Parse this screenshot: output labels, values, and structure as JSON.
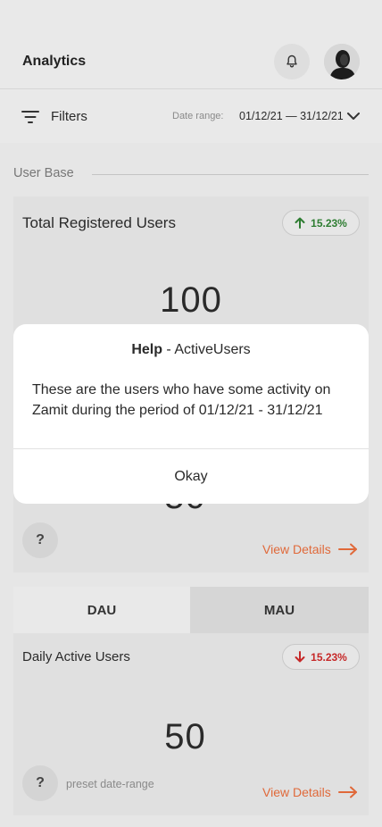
{
  "header": {
    "title": "Analytics",
    "bell_icon": "bell-icon",
    "avatar_icon": "user-avatar"
  },
  "filters": {
    "label": "Filters",
    "date_range_label": "Date range:",
    "date_range_value": "01/12/21 — 31/12/21"
  },
  "section": {
    "title": "User Base"
  },
  "registered_card": {
    "title": "Total Registered Users",
    "badge": "15.23%",
    "badge_direction": "up",
    "value": "100",
    "partial_value": "50",
    "help_label": "?",
    "view_details": "View Details"
  },
  "active_card": {
    "tabs": [
      "DAU",
      "MAU"
    ],
    "title": "Daily Active Users",
    "badge": "15.23%",
    "badge_direction": "down",
    "value": "50",
    "help_label": "?",
    "preset": "preset date-range",
    "view_details": "View Details"
  },
  "help_modal": {
    "title_bold": "Help",
    "title_rest": " - ActiveUsers",
    "body": "These are the users who have some activity on Zamit during the period of 01/12/21 - 31/12/21",
    "okay": "Okay"
  },
  "colors": {
    "accent": "#e0693a",
    "up": "#2e7d32",
    "down": "#c62828"
  }
}
